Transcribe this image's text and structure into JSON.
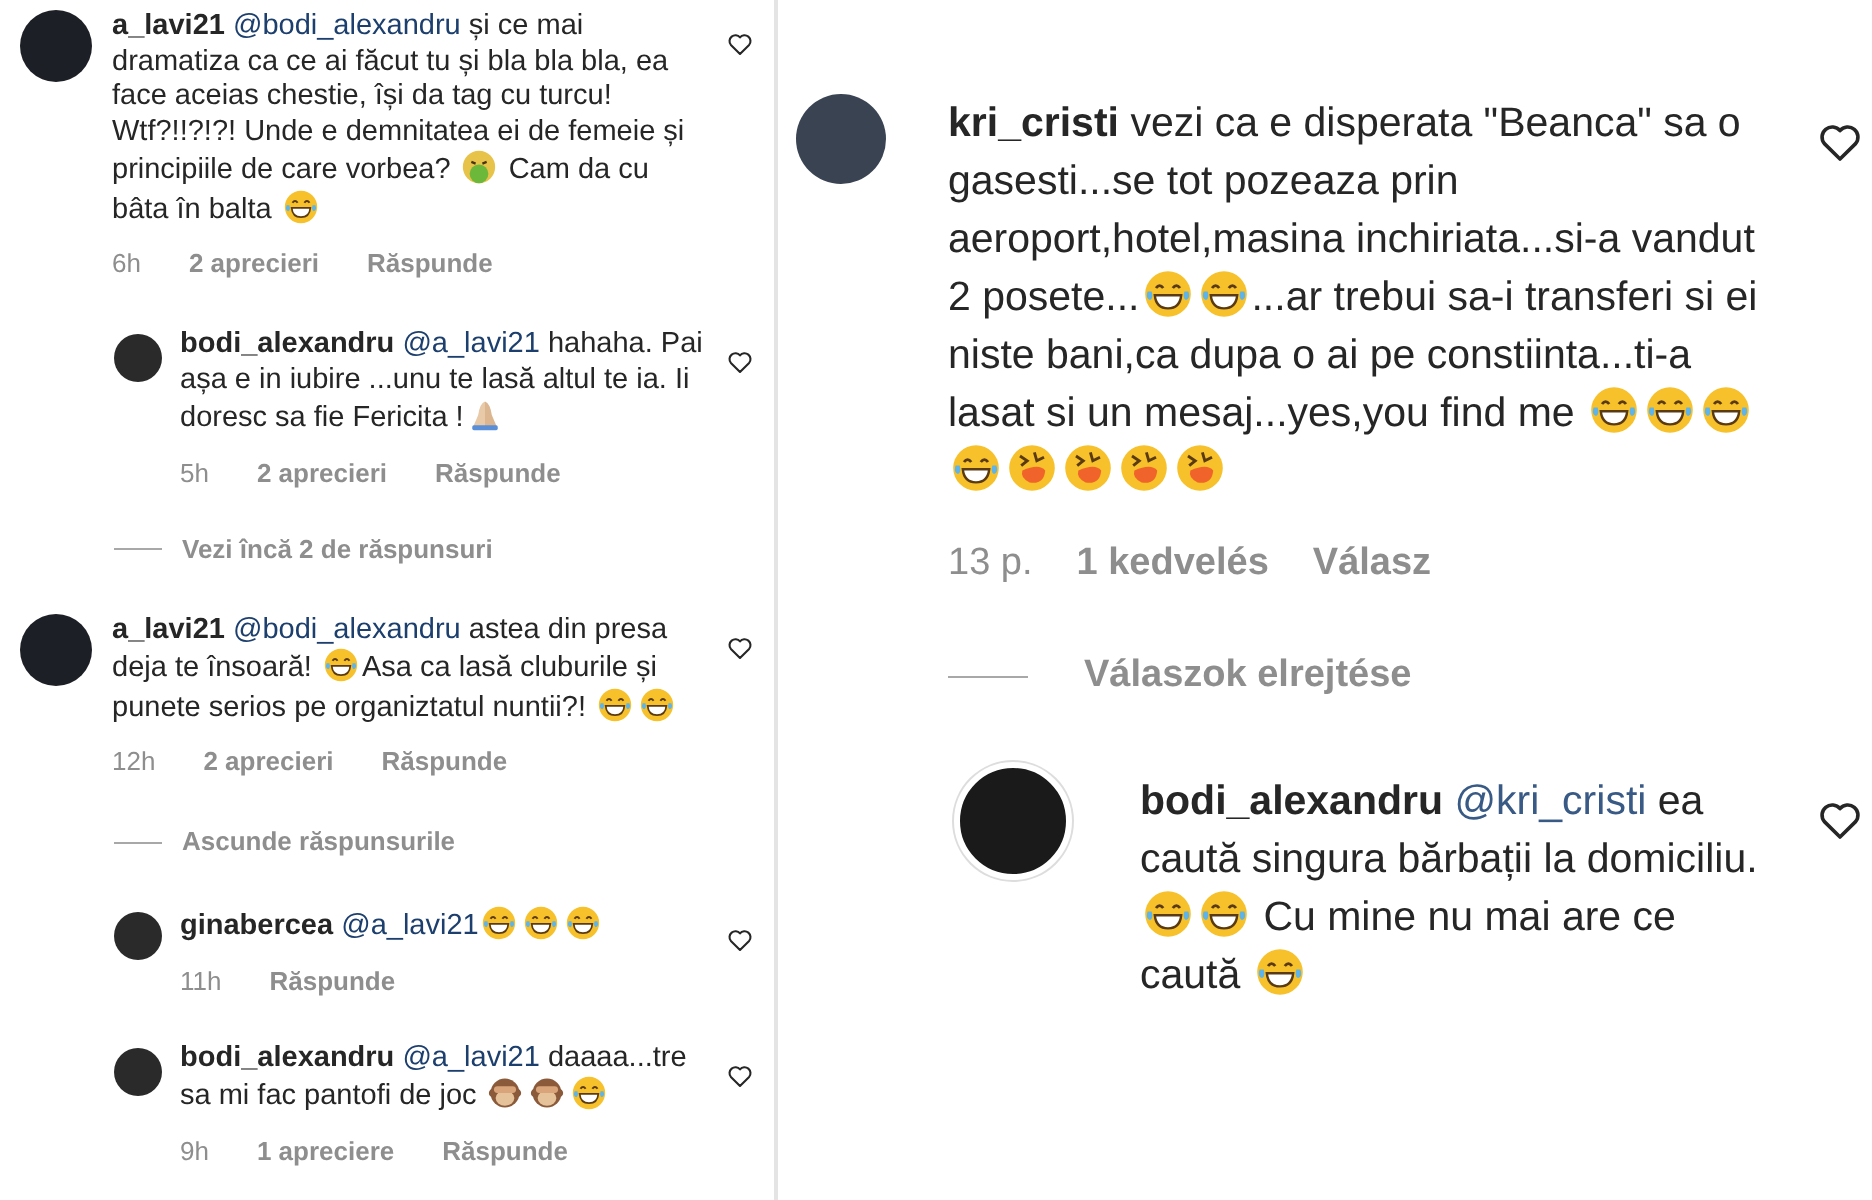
{
  "panels": [
    {
      "kind": "compact",
      "items": [
        {
          "kind": "comment",
          "user": "a_lavi21",
          "parts": [
            {
              "kind": "mention",
              "text": "@bodi_alexandru"
            },
            {
              "kind": "text",
              "text": " și  ce mai dramatiza ca ce ai făcut tu și bla bla bla, ea face aceias chestie, își da tag cu turcu! Wtf?!!?!?! Unde e demnitatea ei de femeie și principiile de care vorbea? "
            },
            {
              "kind": "nauseated"
            },
            {
              "kind": "text",
              "text": " Cam da cu bâta în balta "
            },
            {
              "kind": "laughing"
            }
          ],
          "time": "6h",
          "likes": "2 aprecieri",
          "reply": "Răspunde"
        },
        {
          "kind": "reply",
          "user": "bodi_alexandru",
          "parts": [
            {
              "kind": "mention",
              "text": "@a_lavi21"
            },
            {
              "kind": "text",
              "text": " hahaha. Pai așa e in iubire ...unu te lasă altul te ia. Ii doresc sa fie Fericita !"
            },
            {
              "kind": "praying"
            }
          ],
          "time": "5h",
          "likes": "2 aprecieri",
          "reply": "Răspunde"
        },
        {
          "kind": "toggle",
          "text": "Vezi încă 2 de răspunsuri"
        },
        {
          "kind": "comment",
          "user": "a_lavi21",
          "parts": [
            {
              "kind": "mention",
              "text": "@bodi_alexandru"
            },
            {
              "kind": "text",
              "text": "  astea din presa deja te însoară! "
            },
            {
              "kind": "laughing"
            },
            {
              "kind": "text",
              "text": "Asa ca lasă cluburile și punete serios pe organiztatul nuntii?! "
            },
            {
              "kind": "laughing"
            },
            {
              "kind": "laughing"
            }
          ],
          "time": "12h",
          "likes": "2 aprecieri",
          "reply": "Răspunde"
        },
        {
          "kind": "toggle",
          "text": "Ascunde răspunsurile"
        },
        {
          "kind": "reply",
          "user": "ginabercea",
          "parts": [
            {
              "kind": "mention",
              "text": "@a_lavi21"
            },
            {
              "kind": "laughing"
            },
            {
              "kind": "laughing"
            },
            {
              "kind": "laughing"
            }
          ],
          "time": "11h",
          "reply": "Răspunde"
        },
        {
          "kind": "reply",
          "user": "bodi_alexandru",
          "parts": [
            {
              "kind": "mention",
              "text": "@a_lavi21"
            },
            {
              "kind": "text",
              "text": " daaaa...tre sa mi fac pantofi de joc "
            },
            {
              "kind": "monkey"
            },
            {
              "kind": "monkey"
            },
            {
              "kind": "laughing"
            }
          ],
          "time": "9h",
          "likes": "1 apreciere",
          "reply": "Răspunde"
        }
      ]
    },
    {
      "kind": "large",
      "items": [
        {
          "kind": "comment",
          "user": "kri_cristi",
          "parts": [
            {
              "kind": "text",
              "text": " vezi ca e disperata \"Beanca\" sa o gasesti...se tot pozeaza prin aeroport,hotel,masina inchiriata...si-a vandut 2 posete..."
            },
            {
              "kind": "laughing"
            },
            {
              "kind": "laughing"
            },
            {
              "kind": "text",
              "text": "...ar trebui sa-i transferi si ei niste bani,ca dupa o ai pe constiinta...ti-a lasat si un mesaj...yes,you find me "
            },
            {
              "kind": "laughing"
            },
            {
              "kind": "laughing"
            },
            {
              "kind": "laughing"
            },
            {
              "kind": "laughing"
            },
            {
              "kind": "rolling"
            },
            {
              "kind": "rolling"
            },
            {
              "kind": "rolling"
            },
            {
              "kind": "rolling"
            }
          ],
          "time": "13 p.",
          "likes": "1 kedvelés",
          "reply": "Válasz"
        },
        {
          "kind": "toggle",
          "text": "Válaszok elrejtése"
        },
        {
          "kind": "reply",
          "user": "bodi_alexandru",
          "parts": [
            {
              "kind": "mention",
              "text": "@kri_cristi"
            },
            {
              "kind": "text",
              "text": " ea caută singura bărbații la domiciliu. "
            },
            {
              "kind": "laughing"
            },
            {
              "kind": "laughing"
            },
            {
              "kind": "text",
              "text": " Cu mine nu mai are ce caută "
            },
            {
              "kind": "laughing"
            }
          ]
        }
      ]
    }
  ]
}
